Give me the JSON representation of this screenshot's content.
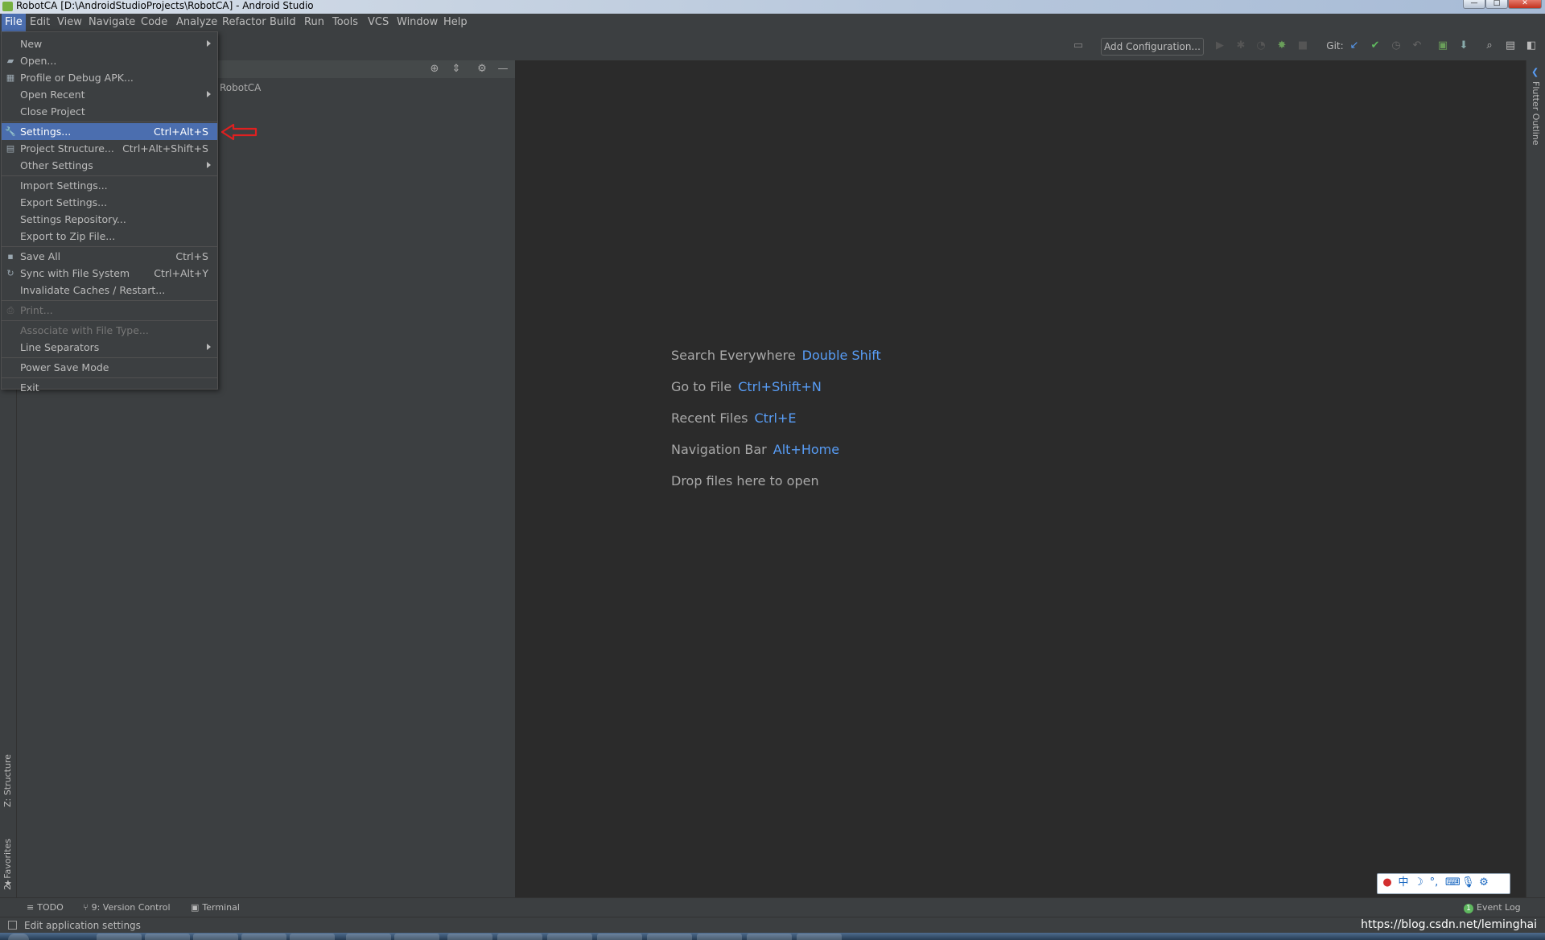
{
  "window": {
    "title": "RobotCA [D:\\AndroidStudioProjects\\RobotCA] - Android Studio",
    "controls": {
      "minimize": "—",
      "maximize": "□",
      "close": "✕"
    }
  },
  "menubar": {
    "items": [
      "File",
      "Edit",
      "View",
      "Navigate",
      "Code",
      "Analyze",
      "Refactor",
      "Build",
      "Run",
      "Tools",
      "VCS",
      "Window",
      "Help"
    ]
  },
  "toolbar": {
    "add_configuration": "Add Configuration...",
    "git_label": "Git:"
  },
  "project_panel": {
    "root_label": "RobotCA"
  },
  "file_menu": {
    "items": [
      {
        "label": "New",
        "shortcut": ""
      },
      {
        "label": "Open...",
        "shortcut": ""
      },
      {
        "label": "Profile or Debug APK...",
        "shortcut": ""
      },
      {
        "label": "Open Recent",
        "shortcut": ""
      },
      {
        "label": "Close Project",
        "shortcut": ""
      },
      {
        "label": "Settings...",
        "shortcut": "Ctrl+Alt+S"
      },
      {
        "label": "Project Structure...",
        "shortcut": "Ctrl+Alt+Shift+S"
      },
      {
        "label": "Other Settings",
        "shortcut": ""
      },
      {
        "label": "Import Settings...",
        "shortcut": ""
      },
      {
        "label": "Export Settings...",
        "shortcut": ""
      },
      {
        "label": "Settings Repository...",
        "shortcut": ""
      },
      {
        "label": "Export to Zip File...",
        "shortcut": ""
      },
      {
        "label": "Save All",
        "shortcut": "Ctrl+S"
      },
      {
        "label": "Sync with File System",
        "shortcut": "Ctrl+Alt+Y"
      },
      {
        "label": "Invalidate Caches / Restart...",
        "shortcut": ""
      },
      {
        "label": "Print...",
        "shortcut": ""
      },
      {
        "label": "Associate with File Type...",
        "shortcut": ""
      },
      {
        "label": "Line Separators",
        "shortcut": ""
      },
      {
        "label": "Power Save Mode",
        "shortcut": ""
      },
      {
        "label": "Exit",
        "shortcut": ""
      }
    ]
  },
  "welcome": {
    "hints": [
      {
        "label": "Search Everywhere",
        "key": "Double Shift"
      },
      {
        "label": "Go to File",
        "key": "Ctrl+Shift+N"
      },
      {
        "label": "Recent Files",
        "key": "Ctrl+E"
      },
      {
        "label": "Navigation Bar",
        "key": "Alt+Home"
      },
      {
        "label": "Drop files here to open",
        "key": ""
      }
    ]
  },
  "side_tabs": {
    "structure": "Z: Structure",
    "favorites": "2: Favorites",
    "flutter_outline": "Flutter Outline"
  },
  "bottom_tools": {
    "todo": "TODO",
    "version_control": "9: Version Control",
    "terminal": "Terminal",
    "event_log": "Event Log",
    "event_log_badge": "1"
  },
  "statusbar": {
    "text": "Edit application settings",
    "watermark": "https://blog.csdn.net/leminghai"
  },
  "colors": {
    "accent": "#4b6eaf",
    "link": "#589df6",
    "background": "#2b2b2b",
    "panel": "#3c3f41",
    "annotation_arrow": "#e02020"
  }
}
